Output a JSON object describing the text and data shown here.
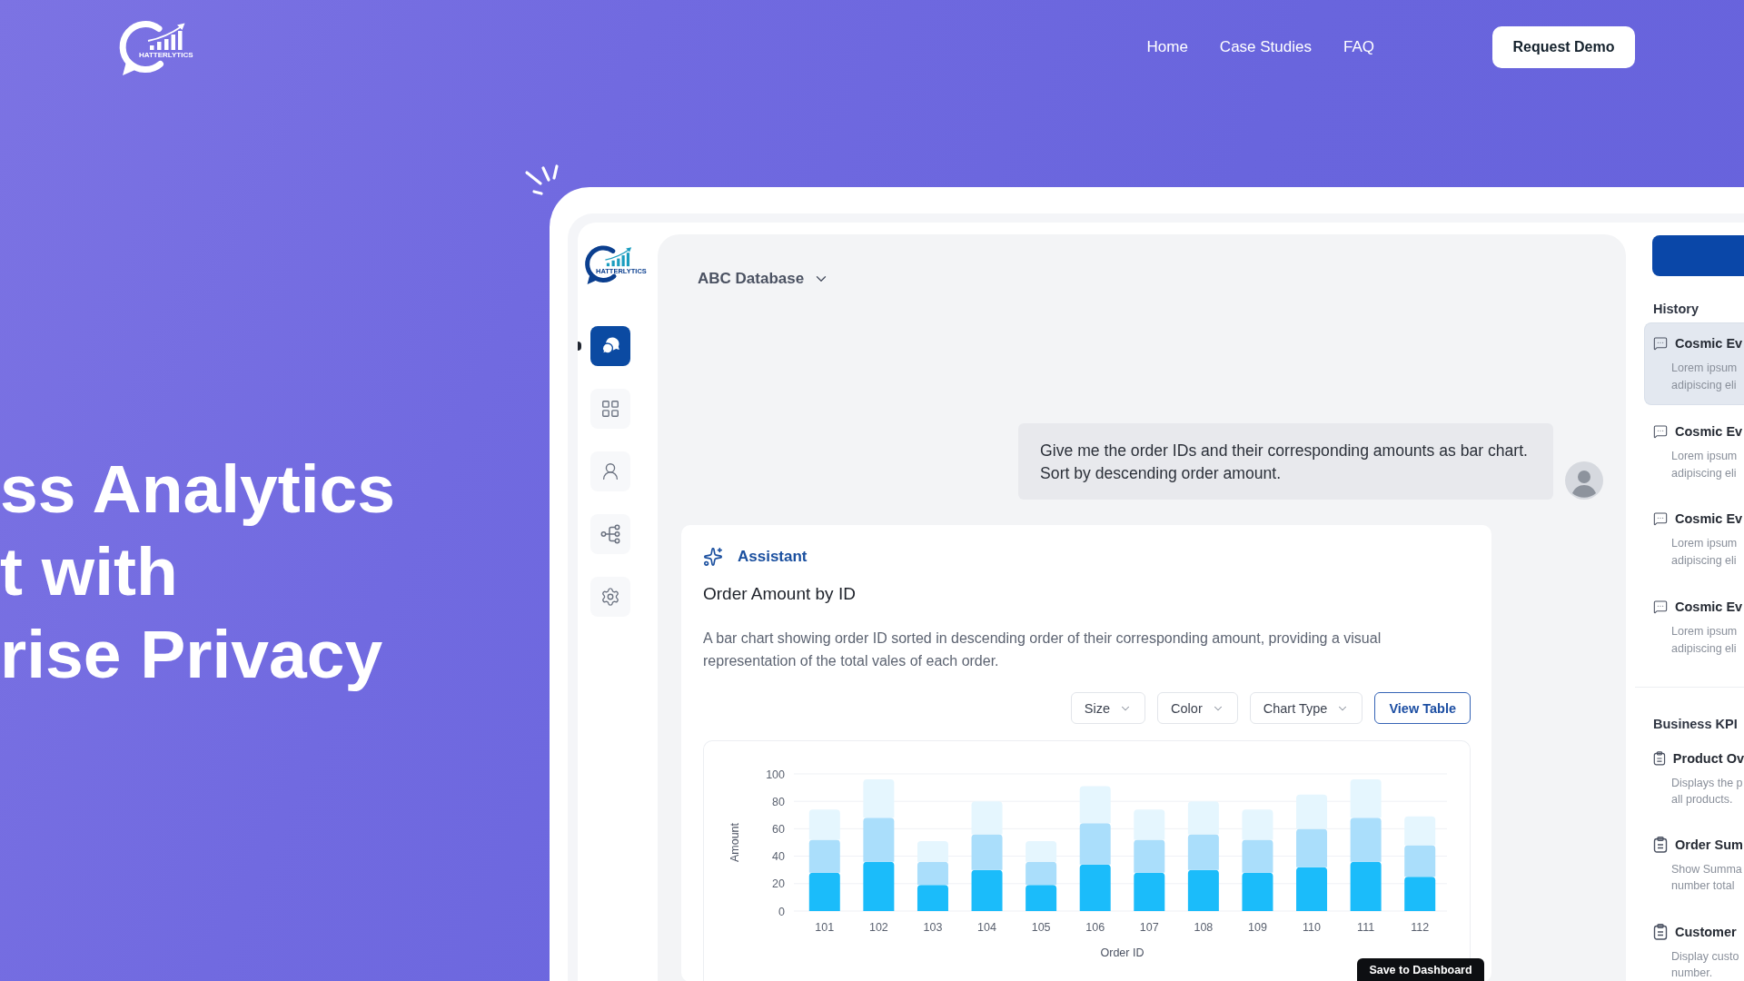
{
  "header": {
    "logo_text": "HATTERLYTICS",
    "nav_links": [
      "Home",
      "Case Studies",
      "FAQ"
    ],
    "cta": "Request Demo"
  },
  "hero": {
    "headline_lines": [
      "ss Analytics",
      "t with",
      "rise Privacy"
    ]
  },
  "app": {
    "logo_text": "HATTERLYTICS",
    "sidebar_items": [
      {
        "selected": true
      },
      {
        "selected": false
      },
      {
        "selected": false
      },
      {
        "selected": false
      },
      {
        "selected": false
      }
    ],
    "database": "ABC Database",
    "user_message_lines": [
      "Give me the order IDs and their corresponding amounts as bar chart.",
      "Sort by descending order amount."
    ],
    "assistant": {
      "label": "Assistant",
      "title": "Order Amount by ID",
      "description_lines": [
        "A bar chart showing order ID sorted in descending order of their corresponding amount, providing a visual",
        "representation of the total vales of each order."
      ],
      "controls": [
        {
          "kind": "dropdown",
          "label": "Size"
        },
        {
          "kind": "dropdown",
          "label": "Color"
        },
        {
          "kind": "dropdown",
          "label": "Chart Type"
        },
        {
          "kind": "button",
          "label": "View Table"
        }
      ],
      "chart_data": {
        "type": "bar",
        "stacked": true,
        "grid": true,
        "xlabel": "Order ID",
        "ylabel": "Amount",
        "categories": [
          "101",
          "102",
          "103",
          "104",
          "105",
          "106",
          "107",
          "108",
          "109",
          "110",
          "111",
          "112"
        ],
        "ylim": [
          0,
          100
        ],
        "yticks": [
          0,
          20,
          40,
          60,
          80,
          100
        ],
        "series": [
          {
            "color": "#1bbcfa",
            "values": [
              28,
              36,
              19,
              30,
              19,
              34,
              28,
              30,
              28,
              32,
              36,
              25
            ]
          },
          {
            "color": "#aadefb",
            "values": [
              24,
              32,
              17,
              26,
              17,
              30,
              24,
              26,
              24,
              28,
              32,
              23
            ]
          },
          {
            "color": "#e5f6fe",
            "values": [
              22,
              28,
              15,
              24,
              15,
              27,
              22,
              24,
              22,
              25,
              28,
              21
            ]
          }
        ]
      },
      "save_button": "Save to Dashboard"
    },
    "history": {
      "title": "History",
      "items": [
        {
          "title": "Cosmic Ev",
          "preview_lines": [
            "Lorem ipsum",
            "adipiscing eli"
          ],
          "selected": true
        },
        {
          "title": "Cosmic Ev",
          "preview_lines": [
            "Lorem ipsum",
            "adipiscing eli"
          ],
          "selected": false
        },
        {
          "title": "Cosmic Ev",
          "preview_lines": [
            "Lorem ipsum",
            "adipiscing eli"
          ],
          "selected": false
        },
        {
          "title": "Cosmic Ev",
          "preview_lines": [
            "Lorem ipsum",
            "adipiscing eli"
          ],
          "selected": false
        }
      ]
    },
    "kpi": {
      "title": "Business KPI",
      "items": [
        {
          "title": "Product Ov",
          "description_lines": [
            "Displays the p",
            "all products."
          ]
        },
        {
          "title": "Order Sum",
          "description_lines": [
            "Show Summa",
            "number total"
          ]
        },
        {
          "title": "Customer",
          "description_lines": [
            "Display custo",
            "number."
          ]
        }
      ]
    }
  }
}
